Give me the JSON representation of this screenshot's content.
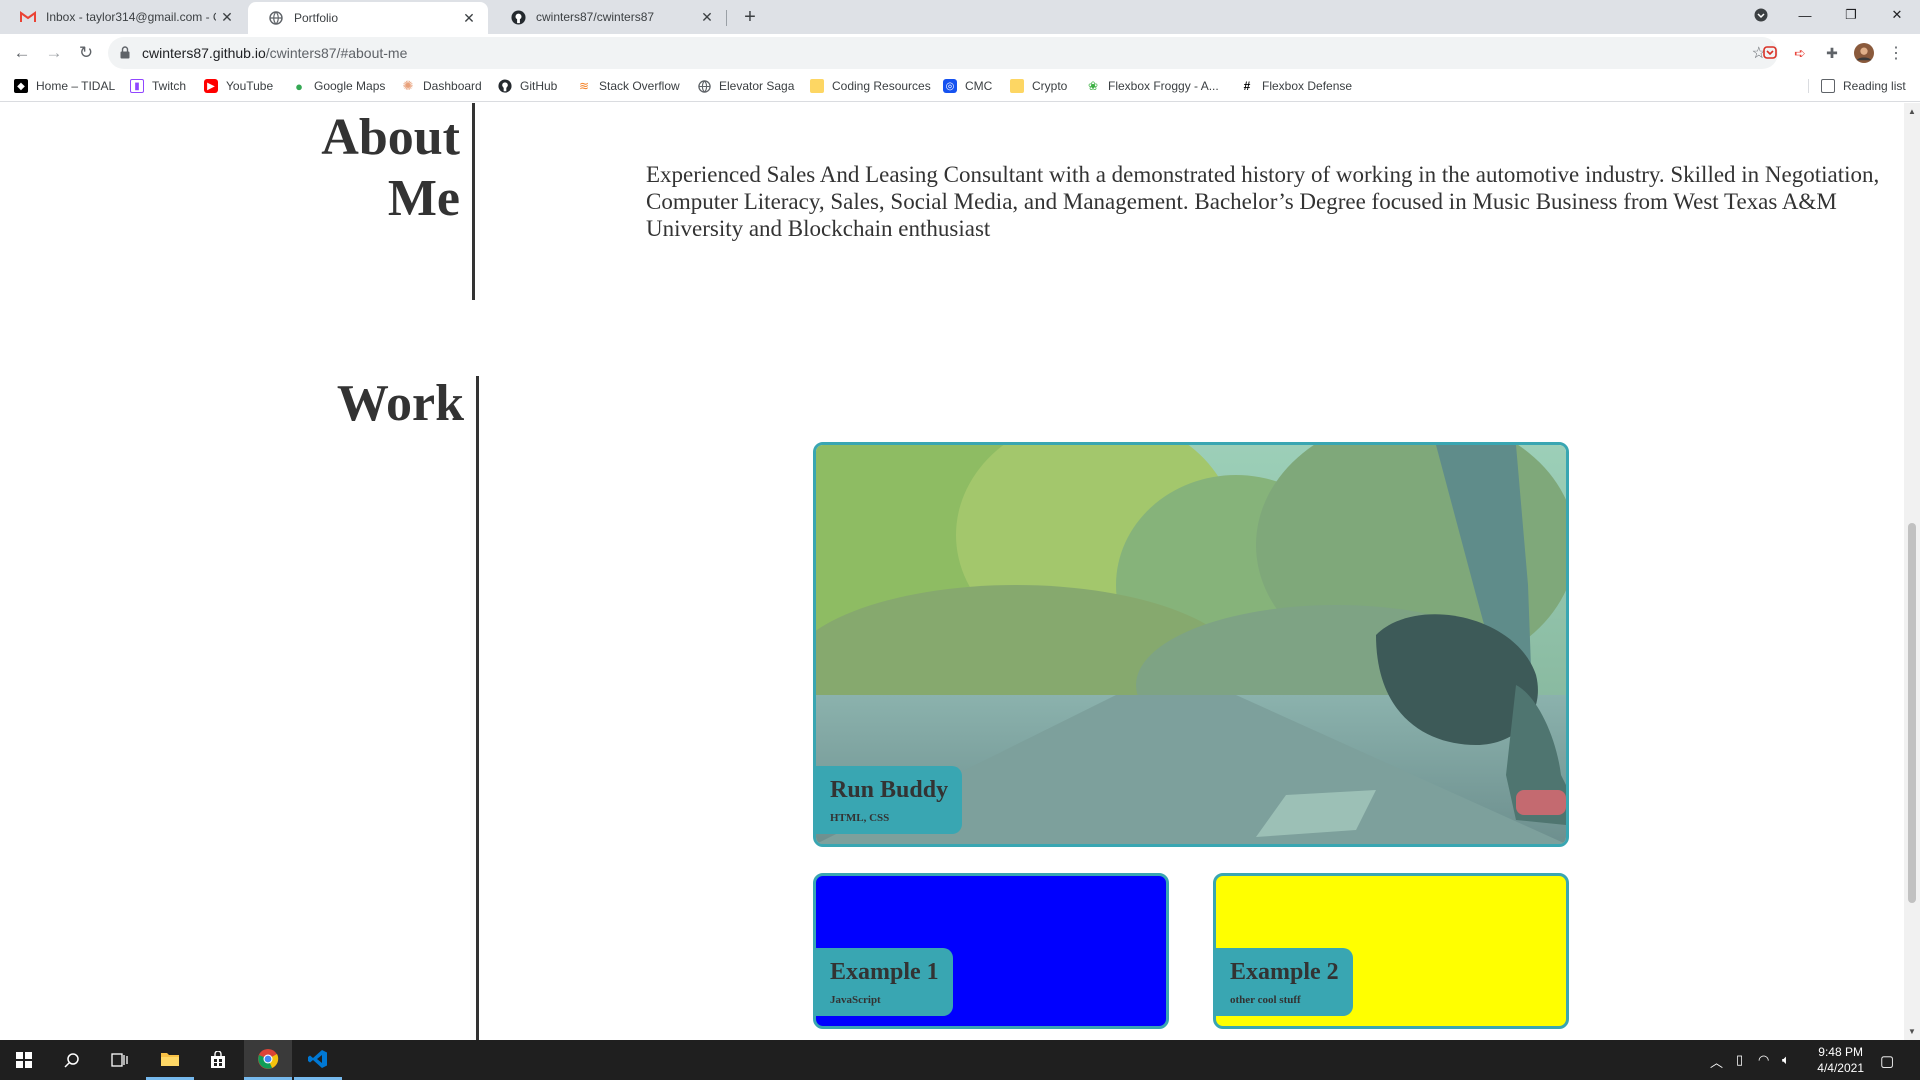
{
  "tabs": [
    {
      "title": "Inbox - taylor314@gmail.com - G",
      "icon": "gmail-icon",
      "active": false
    },
    {
      "title": "Portfolio",
      "icon": "globe-icon",
      "active": true
    },
    {
      "title": "cwinters87/cwinters87",
      "icon": "github-icon",
      "active": false
    }
  ],
  "toolbar": {
    "url_host": "cwinters87.github.io",
    "url_path": "/cwinters87/#about-me"
  },
  "bookmarks": [
    {
      "label": "Home – TIDAL",
      "icon": "tidal-icon",
      "color": "#000000"
    },
    {
      "label": "Twitch",
      "icon": "twitch-icon",
      "color": "#9146ff"
    },
    {
      "label": "YouTube",
      "icon": "youtube-icon",
      "color": "#ff0000"
    },
    {
      "label": "Google Maps",
      "icon": "maps-pin-icon",
      "color": "#34a853"
    },
    {
      "label": "Dashboard",
      "icon": "dashboard-icon",
      "color": "#e8a07a"
    },
    {
      "label": "GitHub",
      "icon": "github-icon",
      "color": "#000000"
    },
    {
      "label": "Stack Overflow",
      "icon": "stackoverflow-icon",
      "color": "#f48024"
    },
    {
      "label": "Elevator Saga",
      "icon": "globe-icon",
      "color": "#5f6368"
    },
    {
      "label": "Coding Resources",
      "icon": "folder-icon",
      "color": "#fdd663"
    },
    {
      "label": "CMC",
      "icon": "cmc-icon",
      "color": "#1652f0"
    },
    {
      "label": "Crypto",
      "icon": "folder-icon",
      "color": "#fdd663"
    },
    {
      "label": "Flexbox Froggy - A...",
      "icon": "frog-icon",
      "color": "#3cb043"
    },
    {
      "label": "Flexbox Defense",
      "icon": "hash-icon",
      "color": "#000000"
    }
  ],
  "reading_list": "Reading list",
  "about": {
    "heading_line1": "About",
    "heading_line2": "Me",
    "text": "Experienced Sales And Leasing Consultant with a demonstrated history of working in the automotive industry. Skilled in Negotiation, Computer Literacy, Sales, Social Media, and Management. Bachelor’s Degree focused in Music Business from West Texas A&M University and Blockchain enthusiast"
  },
  "work": {
    "heading": "Work",
    "projects": [
      {
        "title": "Run Buddy",
        "tech": "HTML, CSS",
        "bg": "photo"
      },
      {
        "title": "Example 1",
        "tech": "JavaScript",
        "bg": "#0000ff"
      },
      {
        "title": "Example 2",
        "tech": "other cool stuff",
        "bg": "#ffff00"
      }
    ]
  },
  "colors": {
    "accent": "#39a6b2",
    "text": "#333333"
  },
  "taskbar": {
    "time": "9:48 PM",
    "date": "4/4/2021"
  }
}
